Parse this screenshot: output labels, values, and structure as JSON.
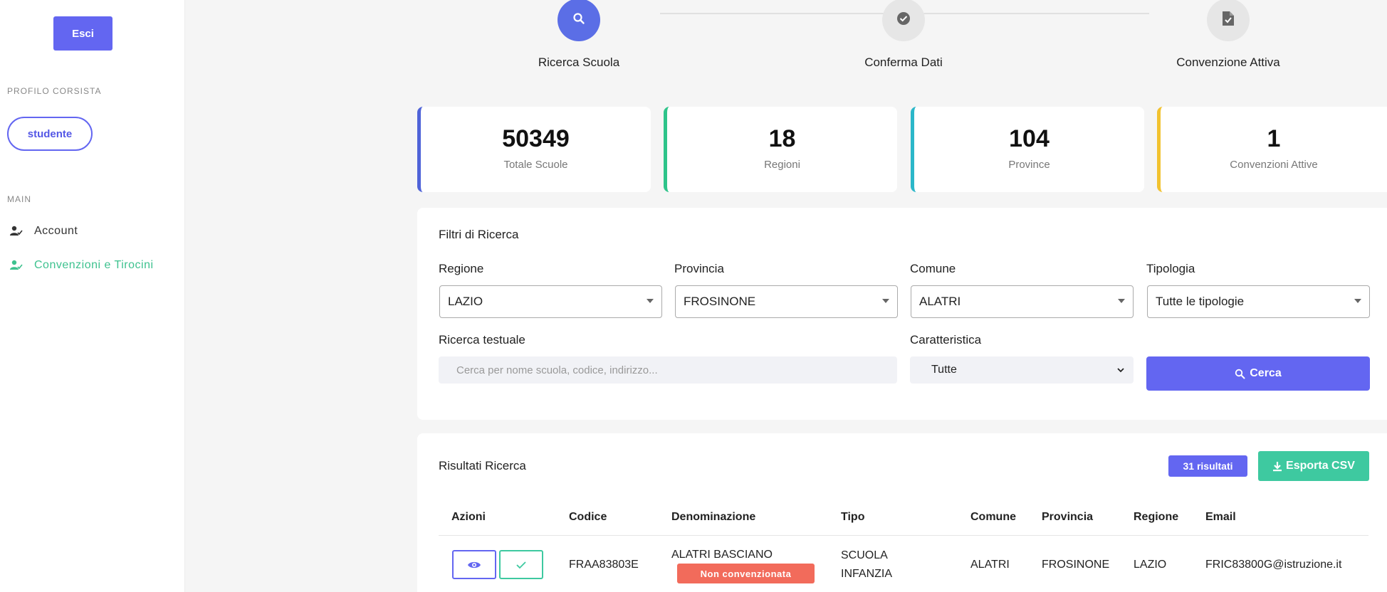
{
  "sidebar": {
    "logout_label": "Esci",
    "profile_section_label": "PROFILO CORSISTA",
    "profile_pill": "studente",
    "main_section_label": "MAIN",
    "items": [
      {
        "label": "Account",
        "icon": "user-check-icon",
        "active": false
      },
      {
        "label": "Convenzioni e Tirocini",
        "icon": "user-check-icon",
        "active": true
      }
    ]
  },
  "stepper": {
    "steps": [
      {
        "label": "Ricerca Scuola",
        "icon": "search-icon",
        "state": "active"
      },
      {
        "label": "Conferma Dati",
        "icon": "check-circle-icon",
        "state": "inactive"
      },
      {
        "label": "Convenzione Attiva",
        "icon": "file-check-icon",
        "state": "inactive"
      }
    ]
  },
  "stats": [
    {
      "value": "50349",
      "label": "Totale Scuole",
      "color": "#4f63d8"
    },
    {
      "value": "18",
      "label": "Regioni",
      "color": "#2ec48a"
    },
    {
      "value": "104",
      "label": "Province",
      "color": "#2bb7c9"
    },
    {
      "value": "1",
      "label": "Convenzioni Attive",
      "color": "#f2c230"
    }
  ],
  "filters": {
    "title": "Filtri di Ricerca",
    "regione": {
      "label": "Regione",
      "value": "LAZIO"
    },
    "provincia": {
      "label": "Provincia",
      "value": "FROSINONE"
    },
    "comune": {
      "label": "Comune",
      "value": "ALATRI"
    },
    "tipologia": {
      "label": "Tipologia",
      "value": "Tutte le tipologie"
    },
    "ricerca": {
      "label": "Ricerca testuale",
      "placeholder": "Cerca per nome scuola, codice, indirizzo..."
    },
    "caratteristica": {
      "label": "Caratteristica",
      "value": "Tutte"
    },
    "search_button": "Cerca"
  },
  "results": {
    "title": "Risultati Ricerca",
    "count_badge": "31 risultati",
    "export_button": "Esporta CSV",
    "columns": [
      "Azioni",
      "Codice",
      "Denominazione",
      "Tipo",
      "Comune",
      "Provincia",
      "Regione",
      "Email"
    ],
    "rows": [
      {
        "codice": "FRAA83803E",
        "denominazione": "ALATRI BASCIANO",
        "status": "Non convenzionata",
        "tipo_line1": "SCUOLA",
        "tipo_line2": "INFANZIA",
        "comune": "ALATRI",
        "provincia": "FROSINONE",
        "regione": "LAZIO",
        "email": "FRIC83800G@istruzione.it"
      }
    ]
  },
  "colors": {
    "primary": "#6366f1",
    "success": "#3ec9a0",
    "danger": "#f26b5b",
    "active_nav": "#3ec28f"
  }
}
